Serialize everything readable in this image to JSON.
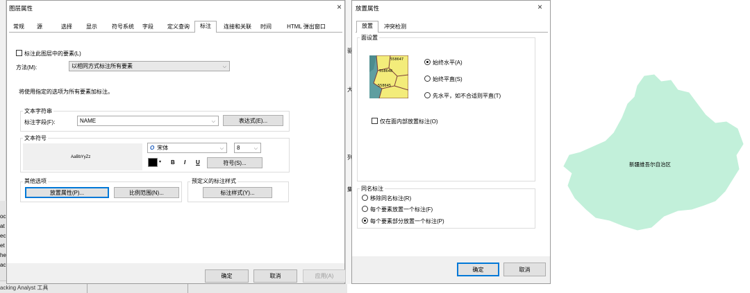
{
  "layer_dialog": {
    "title": "图层属性",
    "close_glyph": "×",
    "tabs": [
      "常规",
      "源",
      "选择",
      "显示",
      "符号系统",
      "字段",
      "定义查询",
      "标注",
      "连接和关联",
      "时间",
      "HTML 弹出窗口"
    ],
    "selected_tab": "标注",
    "label_features_checkbox": "标注此图层中的要素(L)",
    "method_label": "方法(M):",
    "method_value": "以相同方式标注所有要素",
    "info_text": "将使用指定的选项为所有要素加标注。",
    "text_string_group": "文本字符串",
    "label_field_label": "标注字段(F):",
    "label_field_value": "NAME",
    "expression_button": "表达式(E)...",
    "text_symbol_group": "文本符号",
    "preview_text": "AaBbYyZz",
    "font_glyph": "O",
    "font_value": "宋体",
    "size_value": "8",
    "bold_label": "B",
    "italic_label": "I",
    "underline_label": "U",
    "symbol_button": "符号(S)...",
    "other_options_group": "其他选项",
    "placement_button": "放置属性(P)...",
    "scale_range_button": "比例范围(N)...",
    "predefined_group": "预定义的标注样式",
    "label_styles_button": "标注样式(Y)...",
    "ok_button": "确定",
    "cancel_button": "取消",
    "apply_button": "应用(A)"
  },
  "background": {
    "side_fragments": [
      "oc",
      "at",
      "ec",
      "et",
      "he",
      "ac"
    ],
    "bottom_text": "acking Analyst 工具",
    "behind_fragments": [
      "驱",
      "大",
      "列",
      "集"
    ]
  },
  "placement_dialog": {
    "title": "放置属性",
    "close_glyph": "×",
    "tabs": [
      "放置",
      "冲突检测"
    ],
    "selected_tab": "放置",
    "polygon_group": "面设置",
    "preview_labels": [
      "558647",
      "558648",
      "558645"
    ],
    "options": [
      {
        "label": "始终水平(A)",
        "selected": true
      },
      {
        "label": "始终平直(S)",
        "selected": false
      },
      {
        "label": "先水平，如不合适则平直(T)",
        "selected": false
      }
    ],
    "inside_only_checkbox": "仅在面内部放置标注(O)",
    "duplicate_group": "同名标注",
    "duplicate_options": [
      {
        "label": "移除同名标注(R)",
        "selected": false
      },
      {
        "label": "每个要素放置一个标注(F)",
        "selected": false
      },
      {
        "label": "每个要素部分放置一个标注(P)",
        "selected": true
      }
    ],
    "ok_button": "确定",
    "cancel_button": "取消"
  },
  "map": {
    "region_label": "新疆维吾尔自治区",
    "fill_color": "#c2f0da"
  },
  "colors": {
    "dialog_bg": "#ffffff",
    "footer_bg": "#f0f0f0",
    "accent": "#0078d7"
  }
}
